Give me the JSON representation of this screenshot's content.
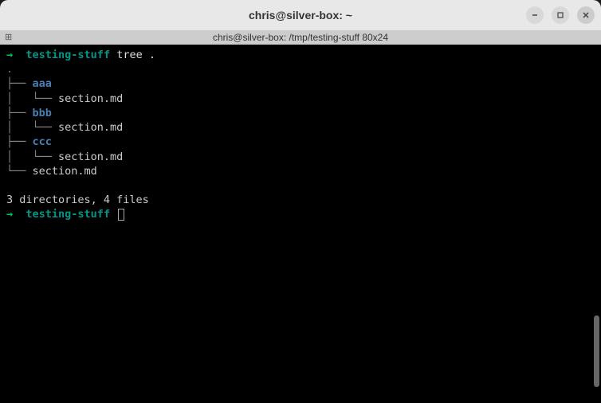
{
  "window": {
    "title": "chris@silver-box: ~",
    "subtitle": "chris@silver-box: /tmp/testing-stuff 80x24"
  },
  "prompt": {
    "arrow": "→",
    "dir": "testing-stuff",
    "command": "tree ."
  },
  "tree": {
    "root": ".",
    "lines": [
      {
        "prefix": "├── ",
        "name": "aaa",
        "type": "dir"
      },
      {
        "prefix": "│   └── ",
        "name": "section.md",
        "type": "file"
      },
      {
        "prefix": "├── ",
        "name": "bbb",
        "type": "dir"
      },
      {
        "prefix": "│   └── ",
        "name": "section.md",
        "type": "file"
      },
      {
        "prefix": "├── ",
        "name": "ccc",
        "type": "dir"
      },
      {
        "prefix": "│   └── ",
        "name": "section.md",
        "type": "file"
      },
      {
        "prefix": "└── ",
        "name": "section.md",
        "type": "file"
      }
    ],
    "summary": "3 directories, 4 files"
  },
  "prompt2": {
    "arrow": "→",
    "dir": "testing-stuff"
  }
}
